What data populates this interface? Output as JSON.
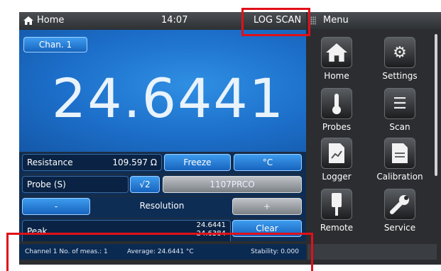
{
  "topbar": {
    "home_label": "Home",
    "time": "14:07",
    "mode": "LOG SCAN"
  },
  "menu": {
    "title": "Menu",
    "items": [
      {
        "label": "Home",
        "icon": "house-icon"
      },
      {
        "label": "Settings",
        "icon": "gears-icon"
      },
      {
        "label": "Probes",
        "icon": "thermometer-icon"
      },
      {
        "label": "Scan",
        "icon": "list-icon"
      },
      {
        "label": "Logger",
        "icon": "log-document-icon"
      },
      {
        "label": "Calibration",
        "icon": "cal-document-icon"
      },
      {
        "label": "Remote",
        "icon": "usb-plug-icon"
      },
      {
        "label": "Service",
        "icon": "wrench-icon"
      }
    ]
  },
  "main": {
    "channel_button": "Chan. 1",
    "reading": "24.6441"
  },
  "controls": {
    "resistance_label": "Resistance",
    "resistance_value": "109.597 Ω",
    "freeze_label": "Freeze",
    "unit_label": "°C",
    "probe_label": "Probe (S)",
    "sqrt_label": "√2",
    "probe_id": "1107PRCO",
    "minus_label": "-",
    "resolution_label": "Resolution",
    "plus_label": "+",
    "peak_label": "Peak",
    "peak_max": "24.6441",
    "peak_min": "24.6384",
    "clear_label": "Clear"
  },
  "status": {
    "channel_meas": "Channel 1 No. of meas.: 1",
    "average": "Average: 24.6441 °C",
    "stability": "Stability: 0.000"
  }
}
